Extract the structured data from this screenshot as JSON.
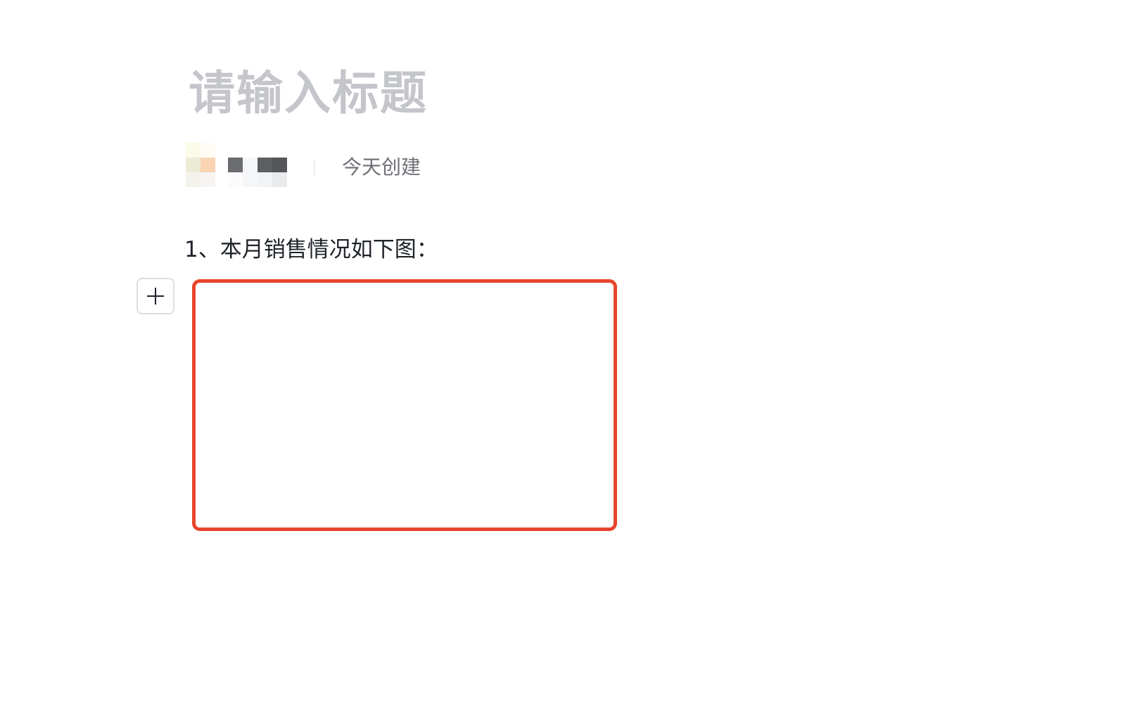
{
  "document": {
    "title_placeholder": "请输入标题",
    "meta": {
      "created_text": "今天创建"
    },
    "body": {
      "paragraph_text": "1、本月销售情况如下图："
    },
    "block_toolbar": {
      "add_icon": "plus-icon"
    }
  },
  "colors": {
    "title_placeholder": "#c4c6cb",
    "body_text": "#1f2329",
    "meta_text": "#6d6f75",
    "highlight_border": "#e6452c"
  }
}
